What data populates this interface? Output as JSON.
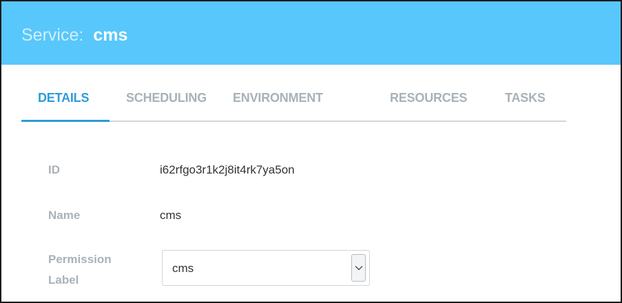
{
  "header": {
    "label": "Service:",
    "service_name": "cms"
  },
  "tabs": [
    {
      "label": "DETAILS",
      "active": true
    },
    {
      "label": "SCHEDULING",
      "active": false
    },
    {
      "label": "ENVIRONMENT",
      "active": false
    },
    {
      "label": "RESOURCES",
      "active": false
    },
    {
      "label": "TASKS",
      "active": false
    }
  ],
  "details": {
    "id_label": "ID",
    "id_value": "i62rfgo3r1k2j8it4rk7ya5on",
    "name_label": "Name",
    "name_value": "cms",
    "permission_label_line1": "Permission",
    "permission_label_line2": "Label",
    "permission_select": {
      "selected": "cms",
      "icon": "chevron-down-icon"
    }
  },
  "colors": {
    "header_bg": "#58c7fb",
    "accent": "#2d9bd9",
    "muted": "#a8b2b8",
    "text": "#333333"
  }
}
